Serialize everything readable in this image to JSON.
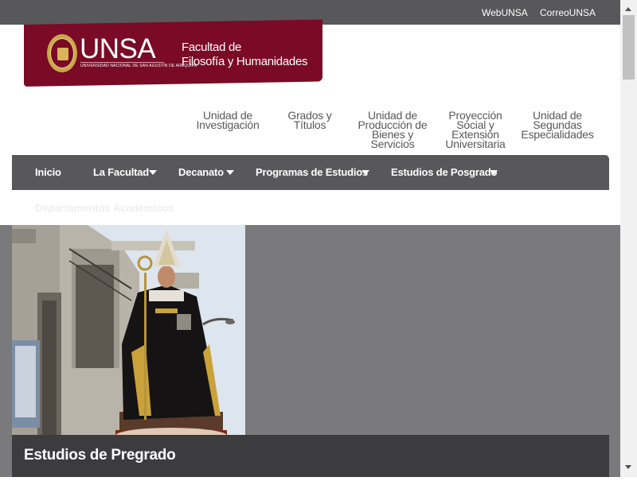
{
  "topbar": {
    "links": [
      "WebUNSA",
      "CorreoUNSA"
    ]
  },
  "brand": {
    "university": "UNSA",
    "tagline": "UNIVERSIDAD NACIONAL DE SAN AGUSTÍN DE AREQUIPA",
    "faculty_line1": "Facultad de",
    "faculty_line2": "Filosofía y Humanidades",
    "color": "#7a0a25"
  },
  "secondary_nav": [
    {
      "label": [
        "Unidad de",
        "Investigación"
      ]
    },
    {
      "label": [
        "Grados y",
        "Títulos"
      ]
    },
    {
      "label": [
        "Unidad de",
        "Producción de",
        "Bienes y",
        "Servicios"
      ]
    },
    {
      "label": [
        "Proyección",
        "Social y",
        "Extensión",
        "Universitaria"
      ]
    },
    {
      "label": [
        "Unidad de",
        "Segundas",
        "Especialidades"
      ]
    }
  ],
  "main_nav": {
    "items": [
      {
        "label": "Inicio",
        "dropdown": false
      },
      {
        "label": "La Facultad",
        "dropdown": true
      },
      {
        "label": "Decanato",
        "dropdown": true
      },
      {
        "label": "Programas de Estudios",
        "dropdown": true
      },
      {
        "label": "Estudios de Posgrado",
        "dropdown": true
      }
    ],
    "overflow_item": "Departamentos Académicos",
    "color": "#58585a"
  },
  "hero": {
    "caption": "Estudios de Pregrado",
    "image_subject": "statue-of-saint-procession-photo"
  },
  "icons": {
    "scroll_up": "scroll-up-arrow-icon",
    "scroll_down": "scroll-down-arrow-icon"
  }
}
